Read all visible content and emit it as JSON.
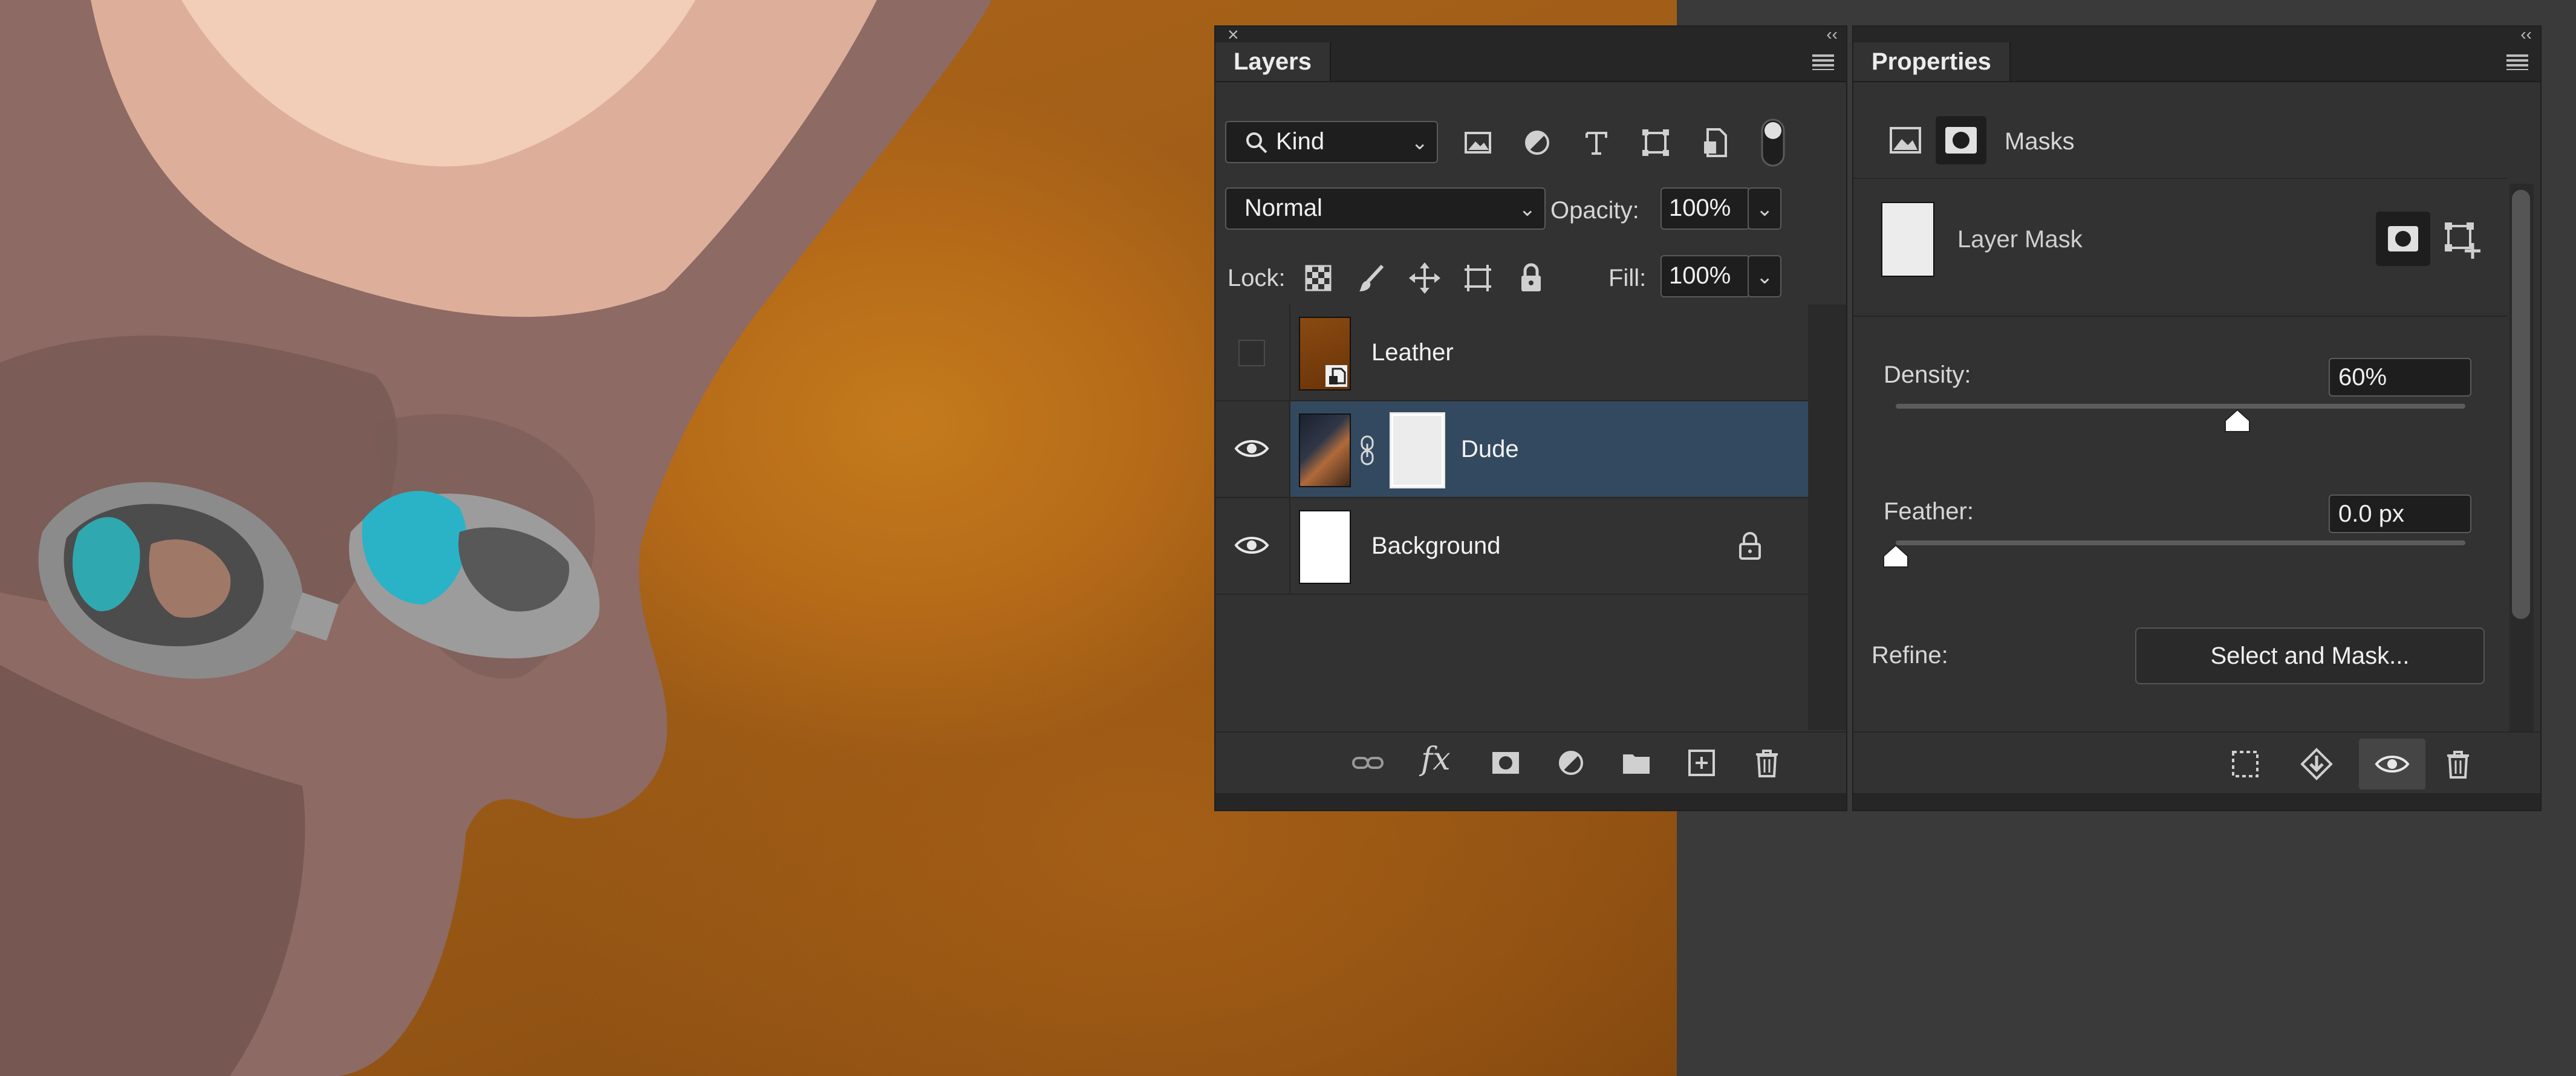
{
  "layers_panel": {
    "tab": "Layers",
    "filter": {
      "kind_label": "Kind"
    },
    "blend_mode": "Normal",
    "opacity_label": "Opacity:",
    "opacity_value": "100%",
    "lock_label": "Lock:",
    "fill_label": "Fill:",
    "fill_value": "100%",
    "layers": [
      {
        "name": "Leather",
        "visible": false,
        "selected": false,
        "locked": false
      },
      {
        "name": "Dude",
        "visible": true,
        "selected": true,
        "locked": false
      },
      {
        "name": "Background",
        "visible": true,
        "selected": false,
        "locked": true
      }
    ]
  },
  "properties_panel": {
    "tab": "Properties",
    "section": "Masks",
    "mask_type": "Layer Mask",
    "density_label": "Density:",
    "density_value": "60%",
    "density_fraction": 0.6,
    "feather_label": "Feather:",
    "feather_value": "0.0 px",
    "feather_fraction": 0.0,
    "refine_label": "Refine:",
    "select_and_mask": "Select and Mask..."
  },
  "colors": {
    "panel_bg": "#323232",
    "selected_row": "#33495f",
    "canvas_leather": "#b0661a"
  }
}
